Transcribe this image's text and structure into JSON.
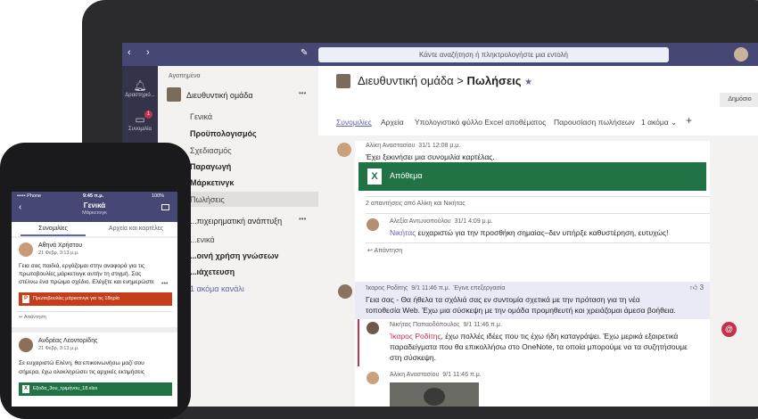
{
  "app": {
    "search_placeholder": "Κάντε αναζήτηση ή πληκτρολογήστε μια εντολή"
  },
  "rail": [
    {
      "label": "Δραστηριό...",
      "icon": "bell-icon"
    },
    {
      "label": "Συνομιλία",
      "icon": "chat-icon",
      "badge": "1"
    },
    {
      "label": "",
      "icon": "teams-icon"
    }
  ],
  "panel": {
    "favorites_label": "Αγαπημένα",
    "team1_name": "Διευθυντική ομάδα",
    "team1_channels": [
      "Γενικά",
      "Προϋπολογισμός",
      "Σχεδιασμός",
      "Παραγωγή",
      "Μάρκετινγκ",
      "Πωλήσεις"
    ],
    "team2_name": "...πιχειρηματική ανάπτυξη",
    "team2_channels": [
      "...ενικά",
      "...οινή χρήση γνώσεων",
      "...ιάχετευση",
      "1 ακόμα κανάλι"
    ],
    "more": "•••"
  },
  "header": {
    "team": "Διευθυντική ομάδα",
    "separator": ">",
    "channel": "Πωλήσεις",
    "star": "★",
    "public_label": "Δημόσιο",
    "tabs": [
      "Συνομιλίες",
      "Αρχεία",
      "Υπολογιστικό φύλλο Excel αποθέματος",
      "Παρουσίαση πωλήσεων",
      "1 ακόμα ⌄"
    ],
    "add_tab": "+"
  },
  "messages": [
    {
      "author": "Αλίκη Αναστασίου",
      "time": "31/1 12:08 μ.μ.",
      "text": "Έχει ξεκινήσει μια συνομιλία καρτέλας."
    },
    {
      "card_title": "Απόθεμα",
      "card_icon": "X"
    },
    {
      "replies": "2 απαντήσεις από Αλίκη και Νικήτας"
    },
    {
      "author": "Αλεξία Αντωνοπούλου",
      "time": "31/1 4:09 μ.μ.",
      "mention": "Νικήτας",
      "text": " ευχαριστώ για την προσθήκη σημαίας–δεν υπήρξε καθυστέρηση, ευτυχώς!"
    },
    {
      "reply_label": "Απάντηση",
      "reply_icon": "↩"
    },
    {
      "author": "Ίκαρος Ροδίτης",
      "time": "9/1 11:46 π.μ.",
      "edited": "Έγινε επεξεργασία",
      "likes": "3",
      "text1": "Γεια σας - Θα ήθελα τα σχόλιά σας εν συντομία σχετικά με την πρόταση για τη νέα",
      "text2": "τοποθεσία Web. Έχω μια σύσκεψη με την ομάδα προμηθευτή και χρειάζομαι άμεσα βοήθεια."
    },
    {
      "author": "Νικήτας Παπαοδόπουλος",
      "time": "9/1 11:46 π.μ.",
      "mention": "Ίκαρος Ροδίτης",
      "text1": ", έχω πολλές ιδέες που τις έχω ήδη καταγράψει. Έχω μερικά εξαιρετικά",
      "text2": "παραδείγματα που θα επικολλήσω στο OneNote, τα οποία μπορούμε να τα συζητήσουμε",
      "text3": "στη σύσκεψη."
    },
    {
      "author": "Αλίκη Αναστασίου",
      "time": "9/1 11:46 π.μ."
    }
  ],
  "phone": {
    "status_carrier": "••••• Phone",
    "status_time": "9:45 π.μ.",
    "status_battery": "100%",
    "title": "Γενικά",
    "subtitle": "Μάρκετινγκ",
    "tabs": [
      "Συνομιλίες",
      "Αρχεία και καρτέλες"
    ],
    "posts": [
      {
        "author": "Αθηνά Χρήστου",
        "time": "21 Φεβρ, 3:13 μ.μ.",
        "text": [
          "Γεια σας παιδιά, εργάζομαι στην αναφορά για τις",
          "πρωτοβουλίες μάρκετινγκ αυτήν τη στιγμή. Σας",
          "στέλνω ένα πρώιμο σχέδιο. Ελέγξτε και ενημερώστε"
        ],
        "file": "Πρωτοβουλίες μάρκετινγκ για τις 18ηρία",
        "reply": "Απάντηση"
      },
      {
        "author": "Ανδρέας Λεοντορίδης",
        "time": "21 Φεβρ, 3:13 μ.μ.",
        "text": [
          "Σε ευχαριστώ Ελένη, θα επικοινωνήσω μαζί σου",
          "σήμερα, έχω ολοκληρώσει τις αρχικές εκτιμήσεις"
        ],
        "file": "Εξοδα_3ου_τριμήνου_18.xlsx"
      }
    ]
  },
  "colors": {
    "brand": "#464775",
    "accent": "#6264a7",
    "excel": "#217346",
    "ppt": "#c43e1c",
    "mention": "#c4314b"
  }
}
